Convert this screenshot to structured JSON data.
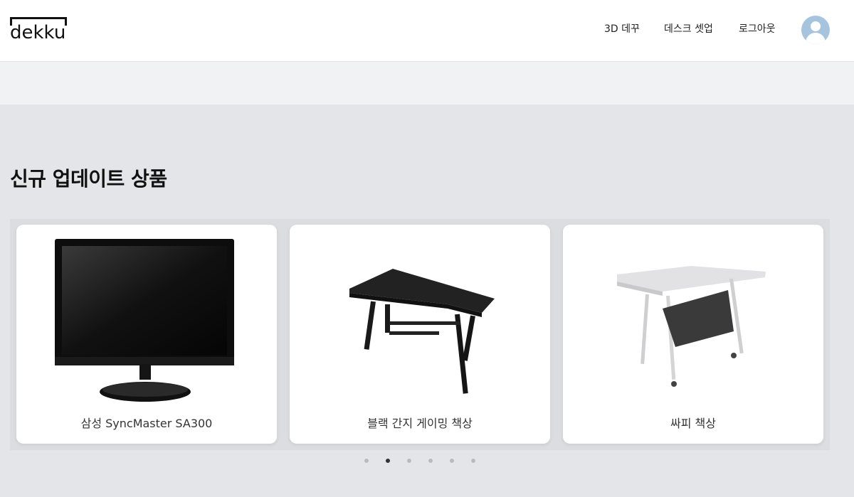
{
  "header": {
    "logo_text": "dekku",
    "nav": {
      "deco_3d": "3D 데꾸",
      "desk_setup": "데스크 셋업",
      "logout": "로그아웃"
    }
  },
  "main": {
    "section_title": "신규 업데이트 상품",
    "products": [
      {
        "name": "삼성 SyncMaster SA300",
        "icon": "monitor-image"
      },
      {
        "name": "블랙 간지 게이밍 책상",
        "icon": "gaming-desk-image"
      },
      {
        "name": "싸피 책상",
        "icon": "white-desk-image"
      }
    ],
    "carousel": {
      "total_pages": 6,
      "active_page": 2
    }
  },
  "colors": {
    "background": "#e4e5e8",
    "header": "#ffffff",
    "band": "#f1f2f4",
    "avatar": "#a7c4df",
    "dot_active": "#333333",
    "dot_inactive": "#b9bbc0"
  }
}
